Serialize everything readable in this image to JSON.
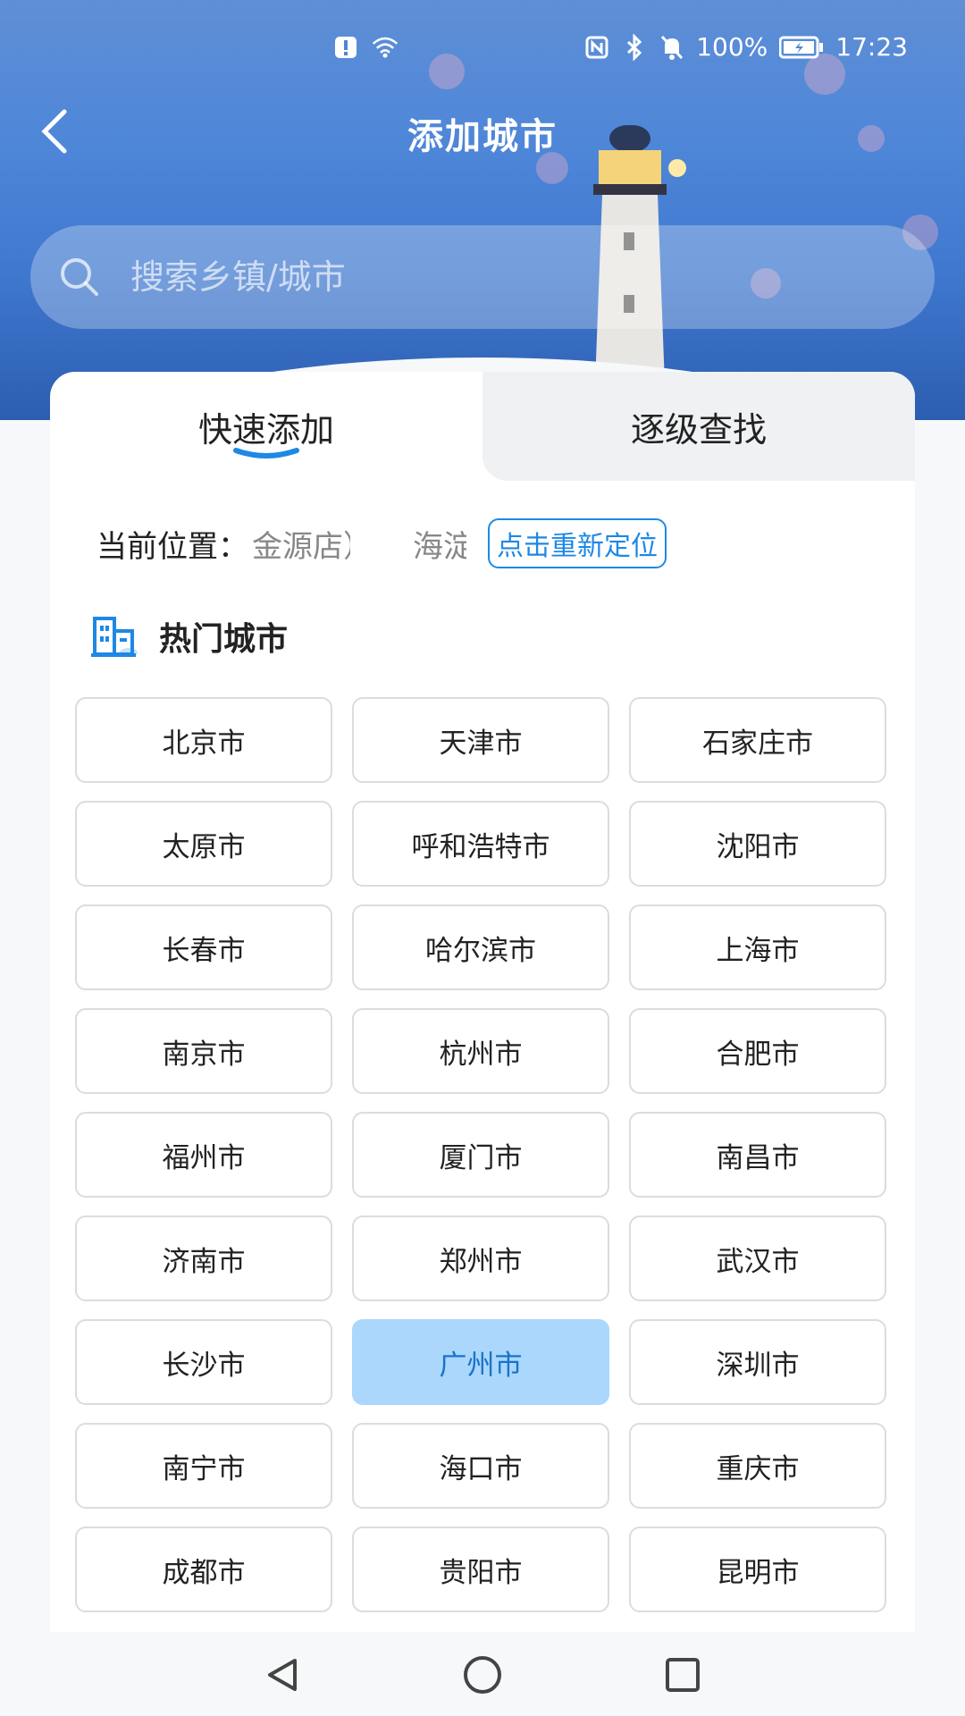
{
  "status_bar": {
    "battery": "100%",
    "time": "17:23"
  },
  "header": {
    "title": "添加城市"
  },
  "search": {
    "placeholder": "搜索乡镇/城市"
  },
  "tabs": [
    {
      "label": "快速添加",
      "active": true
    },
    {
      "label": "逐级查找",
      "active": false
    }
  ],
  "location": {
    "label": "当前位置：",
    "text": "金源店）",
    "city": "海淀",
    "relocate_label": "点击重新定位"
  },
  "hot": {
    "title": "热门城市",
    "cities": [
      "北京市",
      "天津市",
      "石家庄市",
      "太原市",
      "呼和浩特市",
      "沈阳市",
      "长春市",
      "哈尔滨市",
      "上海市",
      "南京市",
      "杭州市",
      "合肥市",
      "福州市",
      "厦门市",
      "南昌市",
      "济南市",
      "郑州市",
      "武汉市",
      "长沙市",
      "广州市",
      "深圳市",
      "南宁市",
      "海口市",
      "重庆市",
      "成都市",
      "贵阳市",
      "昆明市"
    ],
    "selected": "广州市"
  },
  "colors": {
    "accent": "#1e88e5",
    "selected_bg": "#aad7fb"
  }
}
